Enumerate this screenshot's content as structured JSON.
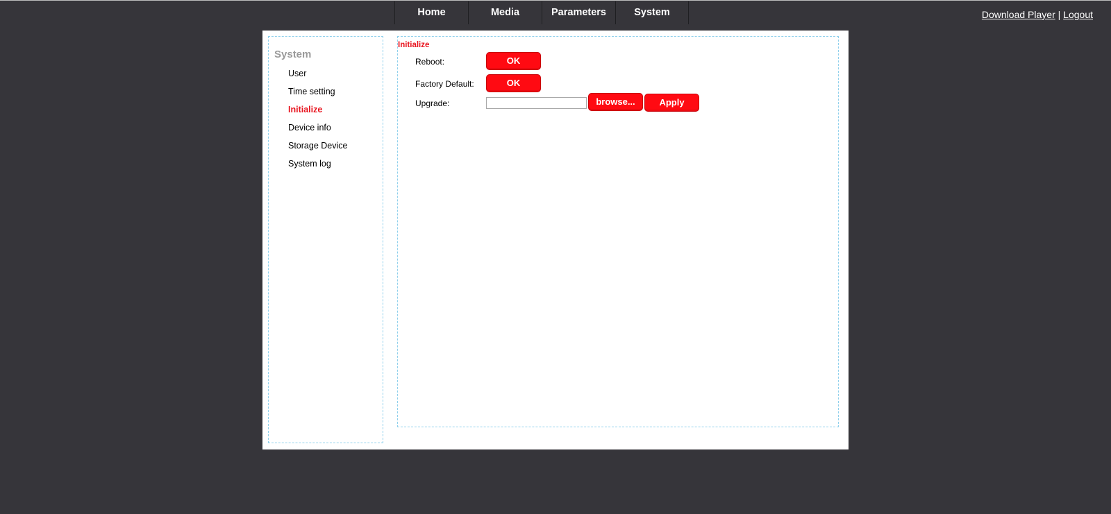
{
  "nav": {
    "items": [
      {
        "label": "Home"
      },
      {
        "label": "Media"
      },
      {
        "label": "Parameters"
      },
      {
        "label": "System"
      }
    ]
  },
  "toplinks": {
    "download_player": "Download Player",
    "separator": "|",
    "logout": "Logout"
  },
  "sidebar": {
    "title": "System",
    "items": [
      {
        "label": "User"
      },
      {
        "label": "Time setting"
      },
      {
        "label": "Initialize"
      },
      {
        "label": "Device info"
      },
      {
        "label": "Storage Device"
      },
      {
        "label": "System log"
      }
    ],
    "active_item": "Initialize"
  },
  "main": {
    "title": "Initialize",
    "reboot": {
      "label": "Reboot:",
      "button": "OK"
    },
    "factory_default": {
      "label": "Factory Default:",
      "button": "OK"
    },
    "upgrade": {
      "label": "Upgrade:",
      "file_value": "",
      "browse_button": "browse...",
      "apply_button": "Apply"
    }
  },
  "colors": {
    "background": "#36353a",
    "accent_red": "#ff0a12",
    "active_text": "#e8141e",
    "dashed_border": "#8fd0ec"
  }
}
